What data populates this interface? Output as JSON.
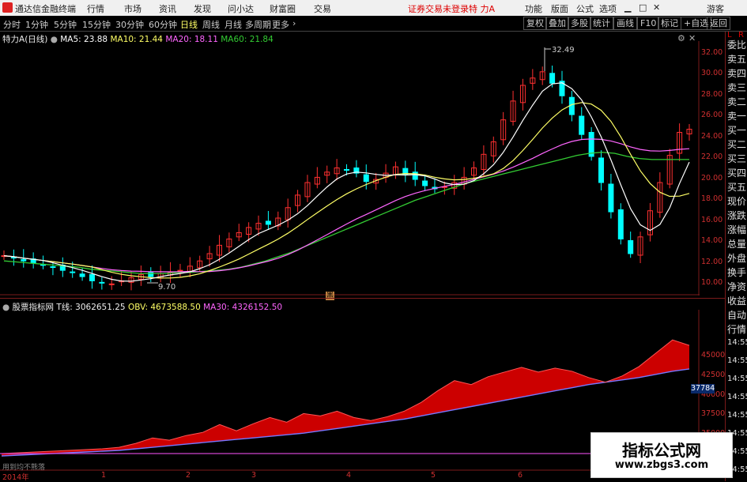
{
  "window": {
    "app_title": "通达信金融终端",
    "menu": [
      "行情",
      "市场",
      "资讯",
      "发现",
      "问小达",
      "财富圈",
      "交易"
    ],
    "login_status": "证券交易未登录",
    "stock_title": "特 力A",
    "right_menu": [
      "功能",
      "版面",
      "公式",
      "选项"
    ],
    "guest": "游客"
  },
  "toolbar": {
    "periods": [
      "分时",
      "1分钟",
      "5分钟",
      "15分钟",
      "30分钟",
      "60分钟",
      "日线",
      "周线",
      "月线",
      "多周期",
      "更多"
    ],
    "active_period": "日线",
    "buttons": [
      "复权",
      "叠加",
      "多股",
      "统计",
      "画线",
      "F10",
      "标记",
      "+自选",
      "返回"
    ]
  },
  "main_chart_header": {
    "stock": "特力A",
    "period_tag": "(日线)",
    "ma5_label": "MA5: 23.88",
    "ma10_label": "MA10: 21.44",
    "ma20_label": "MA20: 18.11",
    "ma60_label": "MA60: 21.84"
  },
  "indicator_header": {
    "panel_name": "股票指标网",
    "t_label": "T线: 3062651.25",
    "obv_label": "OBV: 4673588.50",
    "ma30_label": "MA30: 4326152.50"
  },
  "annotations": {
    "high_label": "32.49",
    "low_label": "9.70",
    "marker": "黑",
    "footer_left": "用到均不熊落",
    "axis_value_box": "37784"
  },
  "right_panel": {
    "top_letters": [
      "L",
      "R"
    ],
    "items": [
      "委比",
      "卖五",
      "卖四",
      "卖三",
      "卖二",
      "卖一",
      "买一",
      "买二",
      "买三",
      "买四",
      "买五",
      "现价",
      "涨跌",
      "涨幅",
      "总量",
      "外盘",
      "换手",
      "净资",
      "收益",
      "自动",
      "行情"
    ],
    "times": [
      "14:55",
      "14:55",
      "14:55",
      "14:55",
      "14:55",
      "14:55",
      "14:55",
      "14:55"
    ]
  },
  "watermark": {
    "line1": "指标公式网",
    "line2": "www.zbgs3.com"
  },
  "colors": {
    "up": "#ff3030",
    "down": "#00ffff",
    "ma5": "#ffffff",
    "ma10": "#ffff66",
    "ma20": "#ff66ff",
    "ma60": "#33cc33",
    "obv_fill": "#cc0000",
    "obv_ma": "#7777ff",
    "axis": "#d03030"
  },
  "chart_data": {
    "type": "line",
    "price_axis_ticks": [
      "32.00",
      "30.00",
      "28.00",
      "26.00",
      "24.00",
      "22.00",
      "20.00",
      "18.00",
      "16.00",
      "14.00",
      "12.00",
      "10.00"
    ],
    "indicator_axis_ticks": [
      "45000",
      "42500",
      "40000",
      "37500",
      "35000",
      "32500"
    ],
    "x_axis_labels": [
      "2014年",
      "1",
      "2",
      "3",
      "4",
      "5",
      "6",
      "7"
    ],
    "close_series": [
      12.6,
      12.4,
      12.1,
      11.9,
      11.7,
      11.5,
      11.2,
      11.0,
      10.6,
      10.2,
      10.0,
      9.9,
      10.2,
      10.5,
      10.8,
      10.6,
      10.9,
      11.0,
      11.2,
      11.6,
      12.1,
      12.8,
      13.6,
      14.2,
      14.8,
      15.3,
      15.7,
      15.6,
      16.2,
      17.2,
      18.4,
      19.6,
      20.1,
      20.6,
      21.0,
      20.8,
      20.5,
      19.7,
      19.9,
      20.5,
      21.1,
      20.4,
      19.9,
      19.3,
      19.0,
      19.2,
      19.6,
      20.1,
      21.0,
      22.3,
      23.5,
      25.6,
      27.4,
      28.9,
      29.6,
      30.2,
      29.1,
      27.9,
      26.1,
      24.2,
      22.1,
      19.6,
      16.8,
      14.2,
      12.8,
      14.4,
      16.9,
      19.6,
      22.2,
      24.4,
      24.7
    ],
    "ma60_series": [
      12.1,
      12.0,
      11.9,
      11.8,
      11.7,
      11.6,
      11.5,
      11.3,
      11.2,
      11.1,
      11.0,
      10.9,
      10.9,
      10.9,
      11.0,
      11.0,
      11.1,
      11.2,
      11.3,
      11.5,
      11.8,
      12.1,
      12.5,
      12.9,
      13.4,
      13.9,
      14.4,
      14.9,
      15.4,
      15.9,
      16.4,
      16.9,
      17.4,
      17.9,
      18.3,
      18.7,
      19.1,
      19.5,
      19.8,
      20.1,
      20.4,
      20.7,
      21.0,
      21.3,
      21.6,
      21.9,
      22.2,
      22.4,
      22.5,
      22.4,
      22.1,
      21.9,
      21.8,
      21.8,
      21.8,
      21.8
    ],
    "obv_series": [
      32500,
      32600,
      32700,
      32800,
      32900,
      33000,
      33100,
      33300,
      33800,
      34500,
      34200,
      34800,
      35200,
      36200,
      35400,
      36300,
      37100,
      36500,
      37600,
      37300,
      37900,
      37100,
      36700,
      37200,
      37900,
      39000,
      40500,
      41800,
      41300,
      42300,
      42900,
      43500,
      42900,
      43400,
      43000,
      42200,
      41600,
      42400,
      43600,
      45300,
      47000,
      46300
    ],
    "obv_ma_series": [
      32200,
      32300,
      32400,
      32500,
      32600,
      32700,
      32800,
      32900,
      33100,
      33300,
      33500,
      33700,
      33900,
      34100,
      34300,
      34500,
      34700,
      34900,
      35100,
      35400,
      35700,
      36000,
      36300,
      36600,
      36900,
      37300,
      37700,
      38100,
      38500,
      38900,
      39300,
      39700,
      40100,
      40500,
      40900,
      41300,
      41600,
      41900,
      42200,
      42600,
      43000,
      43300
    ]
  }
}
